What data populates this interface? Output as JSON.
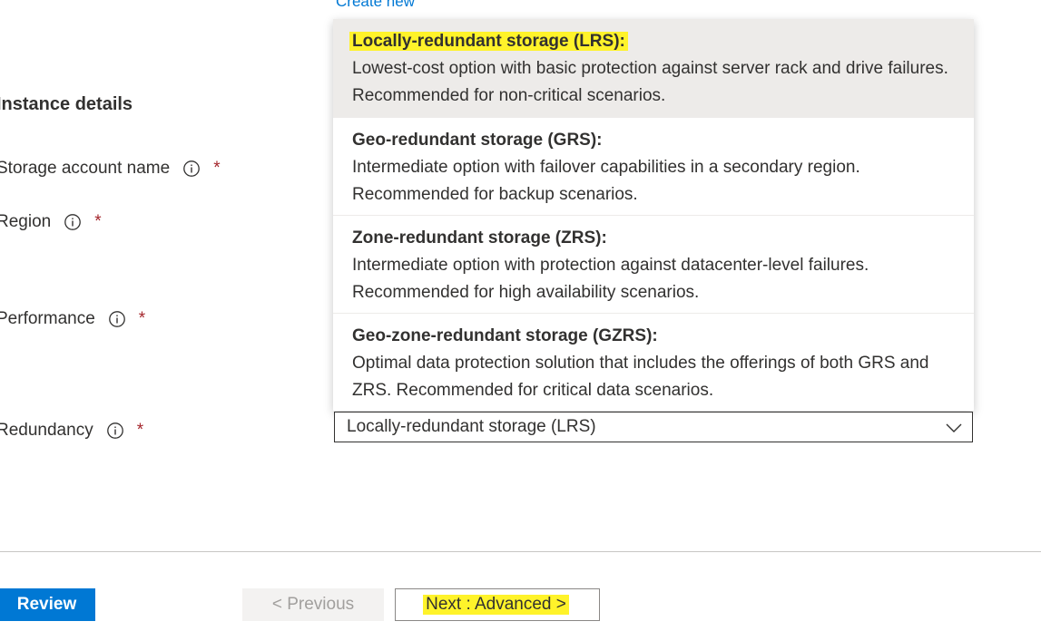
{
  "create_new_link": "Create new",
  "instance_details": {
    "title": "Instance details",
    "fields": [
      {
        "label": "Storage account name",
        "required": "*"
      },
      {
        "label": "Region",
        "required": "*"
      },
      {
        "label": "Performance",
        "required": "*"
      },
      {
        "label": "Redundancy",
        "required": "*"
      }
    ]
  },
  "redundancy": {
    "selected_value": "Locally-redundant storage (LRS)",
    "options": [
      {
        "title": "Locally-redundant storage (LRS):",
        "description": "Lowest-cost option with basic protection against server rack and drive failures. Recommended for non-critical scenarios.",
        "selected": true
      },
      {
        "title": "Geo-redundant storage (GRS):",
        "description": "Intermediate option with failover capabilities in a secondary region. Recommended for backup scenarios."
      },
      {
        "title": "Zone-redundant storage (ZRS):",
        "description": "Intermediate option with protection against datacenter-level failures. Recommended for high availability scenarios."
      },
      {
        "title": "Geo-zone-redundant storage (GZRS):",
        "description": "Optimal data protection solution that includes the offerings of both GRS and ZRS. Recommended for critical data scenarios."
      }
    ]
  },
  "footer": {
    "review_label": "Review",
    "previous_label": "< Previous",
    "next_label": "Next : Advanced >"
  },
  "colors": {
    "accent": "#0078d4",
    "required": "#a4262c",
    "highlight": "#fff32a",
    "selected_option_bg": "#edebe9"
  },
  "icons": [
    "info-icon",
    "chevron-down-icon"
  ]
}
